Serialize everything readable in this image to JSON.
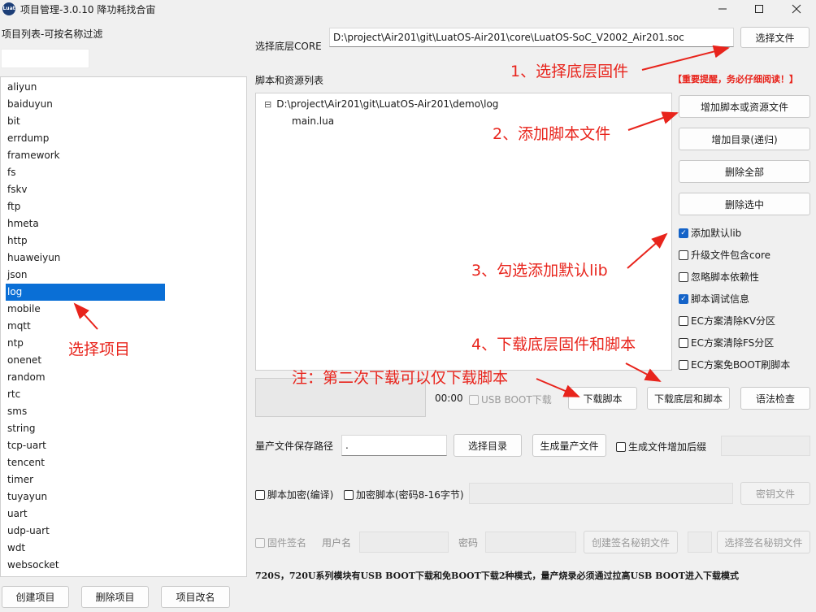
{
  "window": {
    "title": "项目管理-3.0.10 降功耗找合宙",
    "icon_name": "luatools-app-icon"
  },
  "left": {
    "filter_label": "项目列表-可按名称过滤",
    "filter_value": "",
    "projects": [
      "aliyun",
      "baiduyun",
      "bit",
      "errdump",
      "framework",
      "fs",
      "fskv",
      "ftp",
      "hmeta",
      "http",
      "huaweiyun",
      "json",
      "log",
      "mobile",
      "mqtt",
      "ntp",
      "onenet",
      "random",
      "rtc",
      "sms",
      "string",
      "tcp-uart",
      "tencent",
      "timer",
      "tuyayun",
      "uart",
      "udp-uart",
      "wdt",
      "websocket"
    ],
    "selected_project": "log",
    "buttons": {
      "create": "创建项目",
      "delete": "删除项目",
      "rename": "项目改名"
    }
  },
  "core": {
    "label": "选择底层CORE",
    "path": "D:\\project\\Air201\\git\\LuatOS-Air201\\core\\LuatOS-SoC_V2002_Air201.soc",
    "select_button": "选择文件"
  },
  "scripts": {
    "label": "脚本和资源列表",
    "tree_root": "D:\\project\\Air201\\git\\LuatOS-Air201\\demo\\log",
    "tree_children": [
      "main.lua"
    ],
    "collapse_symbol": "⊟"
  },
  "side_buttons": {
    "add_script": "增加脚本或资源文件",
    "add_dir": "增加目录(递归)",
    "delete_all": "删除全部",
    "delete_selected": "删除选中"
  },
  "options": [
    {
      "label": "添加默认lib",
      "checked": true
    },
    {
      "label": "升级文件包含core",
      "checked": false
    },
    {
      "label": "忽略脚本依赖性",
      "checked": false
    },
    {
      "label": "脚本调试信息",
      "checked": true
    },
    {
      "label": "EC方案清除KV分区",
      "checked": false
    },
    {
      "label": "EC方案清除FS分区",
      "checked": false
    },
    {
      "label": "EC方案免BOOT刷脚本",
      "checked": false
    }
  ],
  "download": {
    "timer": "00:00",
    "usb_boot": "USB BOOT下载",
    "download_script": "下载脚本",
    "download_all": "下载底层和脚本",
    "syntax_check": "语法检查"
  },
  "mass_production": {
    "label": "量产文件保存路径",
    "path": ".",
    "select_dir": "选择目录",
    "generate": "生成量产文件",
    "suffix_checkbox": "生成文件增加后缀"
  },
  "encryption": {
    "encrypt_compile": "脚本加密(编译)",
    "encrypt_script": "加密脚本(密码8-16字节)",
    "key_file": "密钥文件"
  },
  "firmware_sign": {
    "checkbox": "固件签名",
    "username_label": "用户名",
    "password_label": "密码",
    "create_key": "创建签名秘钥文件",
    "select_key": "选择签名秘钥文件"
  },
  "footnote": "720S，720U系列模块有USB BOOT下载和免BOOT下载2种模式，量产烧录必须通过拉高USB BOOT进入下载模式",
  "annotations": {
    "step1": "1、选择底层固件",
    "step2": "2、添加脚本文件",
    "step3": "3、勾选添加默认lib",
    "step4": "4、下载底层固件和脚本",
    "note": "注：第二次下载可以仅下载脚本",
    "select_project": "选择项目",
    "warning": "【重要提醒，务必仔细阅读！】",
    "color": "#e8241c"
  }
}
